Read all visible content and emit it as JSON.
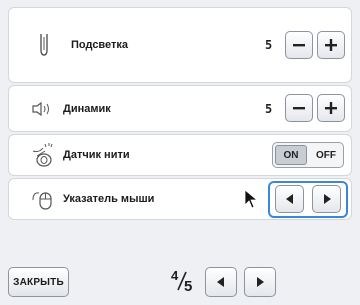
{
  "settings": {
    "backlight": {
      "label": "Подсветка",
      "value": "5"
    },
    "speaker": {
      "label": "Динамик",
      "value": "5"
    },
    "thread_sensor": {
      "label": "Датчик нити",
      "on_label": "ON",
      "off_label": "OFF",
      "state": "ON"
    },
    "mouse_pointer": {
      "label": "Указатель мыши"
    }
  },
  "footer": {
    "close_label": "ЗАКРЫТЬ",
    "page_current": "4",
    "page_total": "5"
  },
  "colors": {
    "accent": "#3a89d8",
    "background": "#eef0f4"
  }
}
